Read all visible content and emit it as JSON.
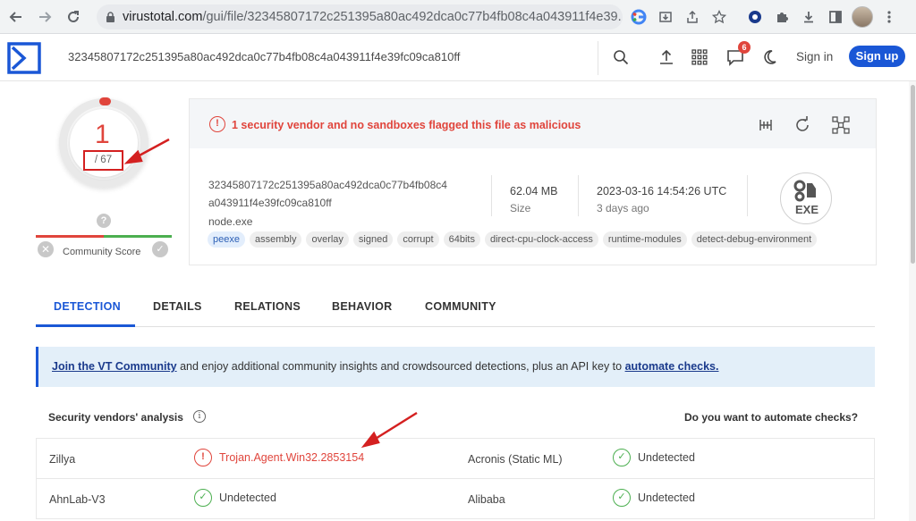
{
  "browser": {
    "url_host": "virustotal.com",
    "url_path": "/gui/file/32345807172c251395a80ac492dca0c77b4fb08c4a043911f4e39..."
  },
  "header": {
    "search_value": "32345807172c251395a80ac492dca0c77b4fb08c4a043911f4e39fc09ca810ff",
    "notification_count": "6",
    "signin_label": "Sign in",
    "signup_label": "Sign up"
  },
  "score": {
    "detections": "1",
    "total": "/ 67",
    "help_glyph": "?",
    "community_label": "Community Score"
  },
  "summary": {
    "alert_glyph": "!",
    "alert_text": "1 security vendor and no sandboxes flagged this file as malicious",
    "hash_line1": "32345807172c251395a80ac492dca0c77b4fb08c4",
    "hash_line2": "a043911f4e39fc09ca810ff",
    "file_name": "node.exe",
    "size_value": "62.04 MB",
    "size_label": "Size",
    "date_value": "2023-03-16 14:54:26 UTC",
    "date_label": "3 days ago",
    "file_type": "EXE",
    "tags": [
      "peexe",
      "assembly",
      "overlay",
      "signed",
      "corrupt",
      "64bits",
      "direct-cpu-clock-access",
      "runtime-modules",
      "detect-debug-environment"
    ]
  },
  "tabs": [
    {
      "label": "DETECTION"
    },
    {
      "label": "DETAILS"
    },
    {
      "label": "RELATIONS"
    },
    {
      "label": "BEHAVIOR"
    },
    {
      "label": "COMMUNITY"
    }
  ],
  "banner": {
    "join_link": "Join the VT Community",
    "middle_text": " and enjoy additional community insights and crowdsourced detections, plus an API key to ",
    "automate_link": "automate checks."
  },
  "vendors": {
    "title": "Security vendors' analysis",
    "info_glyph": "i",
    "automate_question": "Do you want to automate checks?",
    "rows": [
      {
        "left_name": "Zillya",
        "left_result": "Trojan.Agent.Win32.2853154",
        "left_glyph": "!",
        "right_name": "Acronis (Static ML)",
        "right_result": "Undetected",
        "right_glyph": "✓"
      },
      {
        "left_name": "AhnLab-V3",
        "left_result": "Undetected",
        "left_glyph": "✓",
        "right_name": "Alibaba",
        "right_result": "Undetected",
        "right_glyph": "✓"
      }
    ]
  },
  "colors": {
    "malicious": "#e0453c",
    "accent": "#1a57d6",
    "clean": "#4caf50"
  }
}
